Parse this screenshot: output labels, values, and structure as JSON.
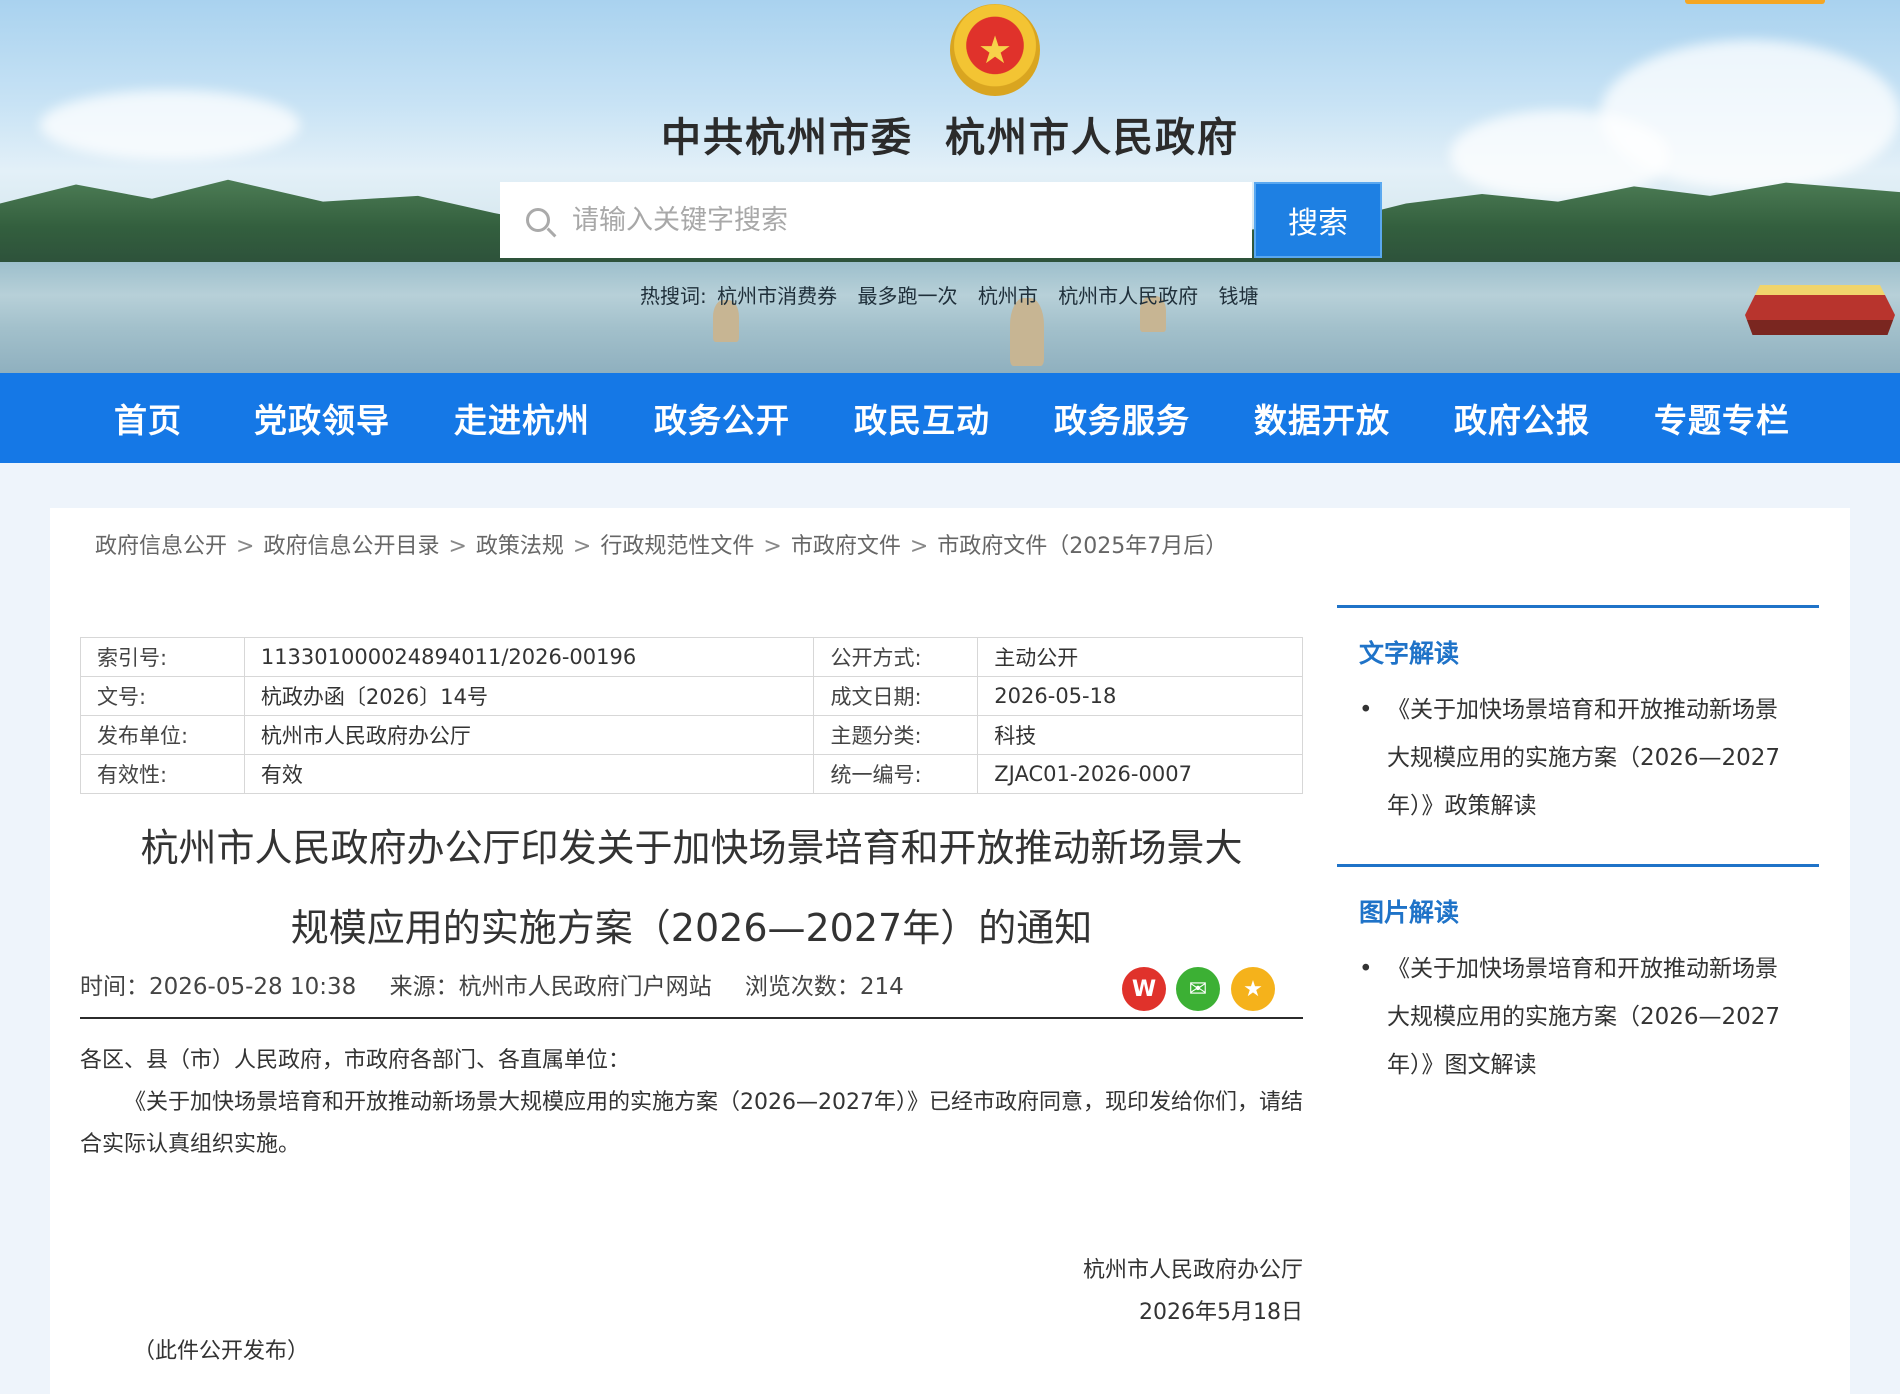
{
  "header": {
    "title_left": "中共杭州市委",
    "title_right": "杭州市人民政府",
    "emblem_icon": "national-emblem-icon",
    "search": {
      "placeholder": "请输入关键字搜索",
      "button_label": "搜索"
    },
    "hot_words_label": "热搜词:",
    "hot_words": [
      "杭州市消费券",
      "最多跑一次",
      "杭州市",
      "杭州市人民政府",
      "钱塘"
    ]
  },
  "nav": {
    "items": [
      "首页",
      "党政领导",
      "走进杭州",
      "政务公开",
      "政民互动",
      "政务服务",
      "数据开放",
      "政府公报",
      "专题专栏"
    ]
  },
  "breadcrumb": [
    "政府信息公开",
    "政府信息公开目录",
    "政策法规",
    "行政规范性文件",
    "市政府文件",
    "市政府文件（2025年7月后）"
  ],
  "meta": {
    "rows": [
      {
        "k1": "索引号:",
        "v1": "113301000024894011/2026-00196",
        "k2": "公开方式:",
        "v2": "主动公开"
      },
      {
        "k1": "文号:",
        "v1": "杭政办函〔2026〕14号",
        "k2": "成文日期:",
        "v2": "2026-05-18"
      },
      {
        "k1": "发布单位:",
        "v1": "杭州市人民政府办公厅",
        "k2": "主题分类:",
        "v2": "科技"
      },
      {
        "k1": "有效性:",
        "v1": "有效",
        "k2": "统一编号:",
        "v2": "ZJAC01-2026-0007"
      }
    ]
  },
  "document": {
    "title_line1": "杭州市人民政府办公厅印发关于加快场景培育和开放推动新场景大",
    "title_line2": "规模应用的实施方案（2026—2027年）的通知",
    "time": "时间：2026-05-28 10:38",
    "source": "来源：杭州市人民政府门户网站",
    "views": "浏览次数：214",
    "salutation": "各区、县（市）人民政府，市政府各部门、各直属单位：",
    "body": "《关于加快场景培育和开放推动新场景大规模应用的实施方案（2026—2027年）》已经市政府同意，现印发给你们，请结合实际认真组织实施。",
    "signature_org": "杭州市人民政府办公厅",
    "signature_date": "2026年5月18日",
    "public_note": "（此件公开发布）",
    "share_icons": [
      "weibo-icon",
      "wechat-icon",
      "favorite-star-icon"
    ]
  },
  "sidebar": {
    "text_reading": {
      "heading": "文字解读",
      "item": "《关于加快场景培育和开放推动新场景大规模应用的实施方案（2026—2027年）》政策解读"
    },
    "image_reading": {
      "heading": "图片解读",
      "item": "《关于加快场景培育和开放推动新场景大规模应用的实施方案（2026—2027年）》图文解读"
    }
  },
  "colors": {
    "nav_blue": "#1578e6",
    "accent_blue": "#1f73c8",
    "search_button": "#1e80e3"
  }
}
